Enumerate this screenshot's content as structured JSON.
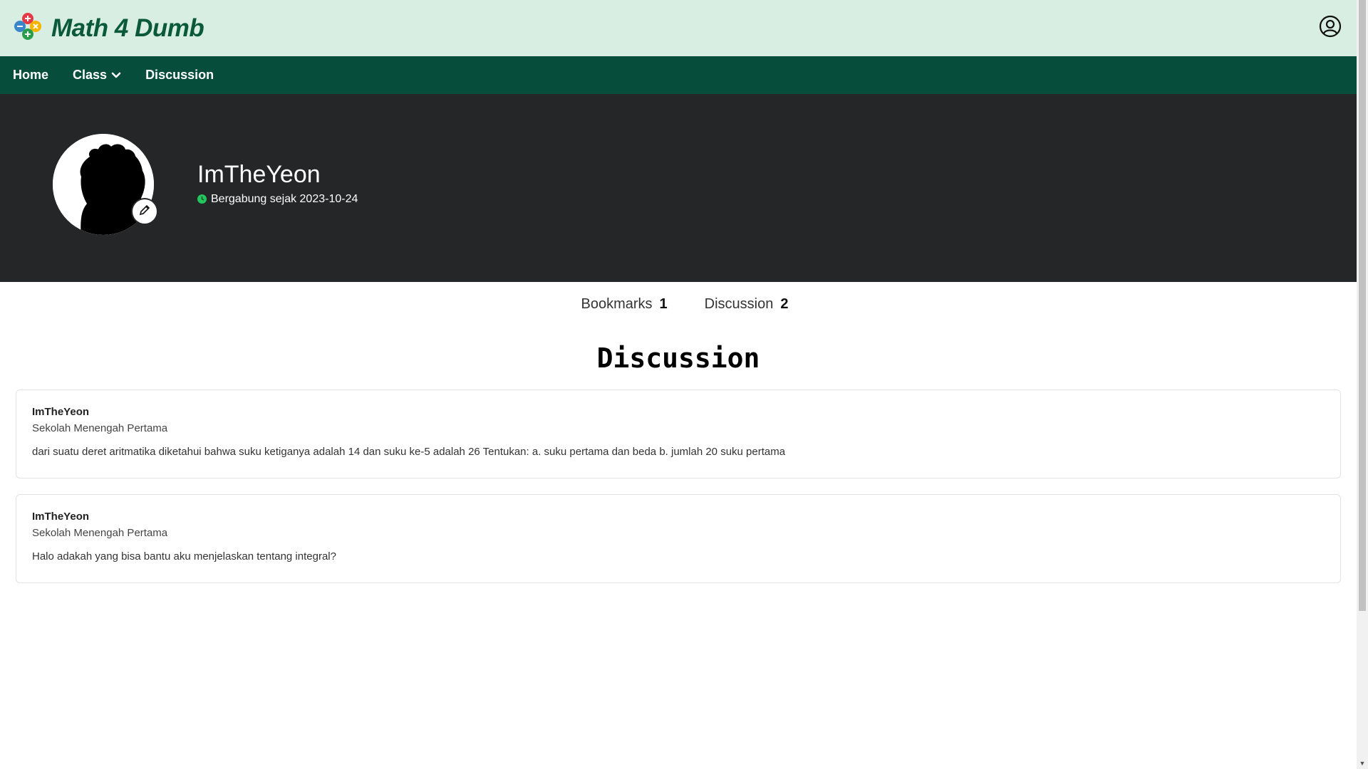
{
  "brand": {
    "title": "Math 4 Dumb",
    "logo_icon": "math-operators-logo"
  },
  "header": {
    "user_icon": "user-circle-icon"
  },
  "nav": {
    "items": [
      {
        "label": "Home"
      },
      {
        "label": "Class",
        "has_dropdown": true
      },
      {
        "label": "Discussion"
      }
    ]
  },
  "profile": {
    "name": "ImTheYeon",
    "joined_text": "Bergabung sejak 2023-10-24",
    "edit_icon": "pencil-icon"
  },
  "tabs": [
    {
      "label": "Bookmarks",
      "count": "1"
    },
    {
      "label": "Discussion",
      "count": "2"
    }
  ],
  "section": {
    "title": "Discussion"
  },
  "posts": [
    {
      "author": "ImTheYeon",
      "school": "Sekolah Menengah Pertama",
      "body": "dari suatu deret aritmatika diketahui bahwa suku ketiganya adalah 14 dan suku ke-5 adalah 26 Tentukan: a. suku pertama dan beda b. jumlah 20 suku pertama"
    },
    {
      "author": "ImTheYeon",
      "school": "Sekolah Menengah Pertama",
      "body": "Halo adakah yang bisa bantu aku menjelaskan tentang integral?"
    }
  ],
  "colors": {
    "topbar_bg": "#d9eee2",
    "nav_bg": "#064e3b",
    "brand_text": "#0a5a3a",
    "profile_bg": "#252628",
    "online_dot": "#22c55e"
  }
}
